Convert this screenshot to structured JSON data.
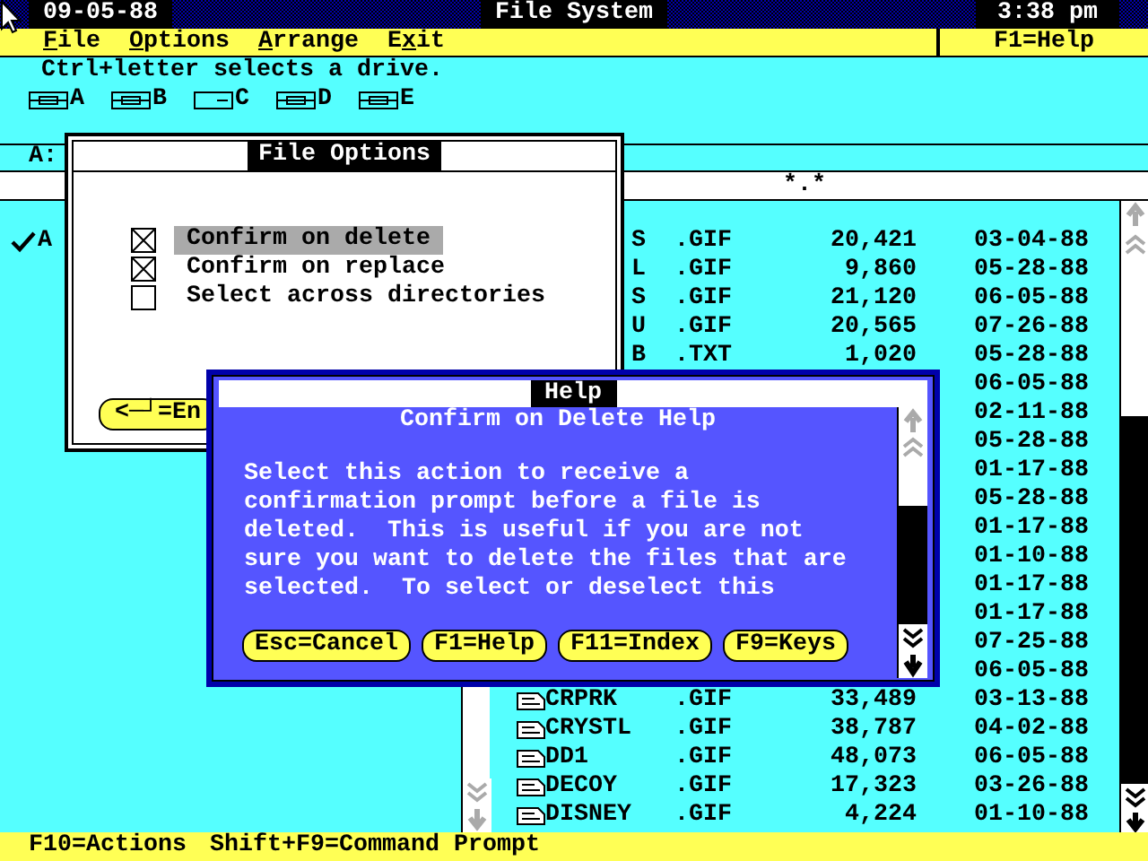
{
  "title_bar": {
    "date": "09-05-88",
    "title": "File System",
    "time": "3:38 pm"
  },
  "menu": [
    {
      "key": "F",
      "post": "ile"
    },
    {
      "key": "O",
      "post": "ptions"
    },
    {
      "key": "A",
      "post": "rrange"
    },
    {
      "pre": "E",
      "key": "x",
      "post": "it"
    }
  ],
  "help_key": "F1=Help",
  "drive_hint": "Ctrl+letter selects a drive.",
  "drives": [
    {
      "letter": "A",
      "kind": "floppy"
    },
    {
      "letter": "B",
      "kind": "floppy"
    },
    {
      "letter": "C",
      "kind": "hard"
    },
    {
      "letter": "D",
      "kind": "floppy"
    },
    {
      "letter": "E",
      "kind": "floppy"
    }
  ],
  "path": "A:",
  "file_filter": "*.*",
  "tree": [
    {
      "label": "A",
      "checked": true
    }
  ],
  "files": [
    {
      "kind": "partial",
      "name": "S",
      "ext": ".GIF",
      "size": "20,421",
      "date": "03-04-88"
    },
    {
      "kind": "partial",
      "name": "L",
      "ext": ".GIF",
      "size": "9,860",
      "date": "05-28-88"
    },
    {
      "kind": "partial",
      "name": "S",
      "ext": ".GIF",
      "size": "21,120",
      "date": "06-05-88"
    },
    {
      "kind": "partial",
      "name": "U",
      "ext": ".GIF",
      "size": "20,565",
      "date": "07-26-88"
    },
    {
      "kind": "partial",
      "name": "B",
      "ext": ".TXT",
      "size": "1,020",
      "date": "05-28-88"
    },
    {
      "kind": "date",
      "date": "06-05-88"
    },
    {
      "kind": "date",
      "date": "02-11-88"
    },
    {
      "kind": "date",
      "date": "05-28-88"
    },
    {
      "kind": "date",
      "date": "01-17-88"
    },
    {
      "kind": "date",
      "date": "05-28-88"
    },
    {
      "kind": "date",
      "date": "01-17-88"
    },
    {
      "kind": "date",
      "date": "01-10-88"
    },
    {
      "kind": "date",
      "date": "01-17-88"
    },
    {
      "kind": "date",
      "date": "01-17-88"
    },
    {
      "kind": "date",
      "date": "07-25-88"
    },
    {
      "kind": "date",
      "date": "06-05-88"
    },
    {
      "kind": "file",
      "name": "CRPRK",
      "ext": ".GIF",
      "size": "33,489",
      "date": "03-13-88"
    },
    {
      "kind": "file",
      "name": "CRYSTL",
      "ext": ".GIF",
      "size": "38,787",
      "date": "04-02-88"
    },
    {
      "kind": "file",
      "name": "DD1",
      "ext": ".GIF",
      "size": "48,073",
      "date": "06-05-88"
    },
    {
      "kind": "file",
      "name": "DECOY",
      "ext": ".GIF",
      "size": "17,323",
      "date": "03-26-88"
    },
    {
      "kind": "file",
      "name": "DISNEY",
      "ext": ".GIF",
      "size": "4,224",
      "date": "01-10-88"
    }
  ],
  "file_options": {
    "title": "File Options",
    "options": [
      {
        "label": "Confirm on delete",
        "checked": true,
        "selected": true
      },
      {
        "label": "Confirm on replace",
        "checked": true,
        "selected": false
      },
      {
        "label": "Select across directories",
        "checked": false,
        "selected": false
      }
    ],
    "button": "<─┘=En"
  },
  "help": {
    "title": "Help",
    "heading": "Confirm on Delete Help",
    "text": "Select this action to receive a\nconfirmation prompt before a file is\ndeleted.  This is useful if you are not\nsure you want to delete the files that are\nselected.  To select or deselect this",
    "buttons": [
      "Esc=Cancel",
      "F1=Help",
      "F11=Index",
      "F9=Keys"
    ]
  },
  "status_bar": [
    "F10=Actions",
    "Shift+F9=Command Prompt"
  ]
}
